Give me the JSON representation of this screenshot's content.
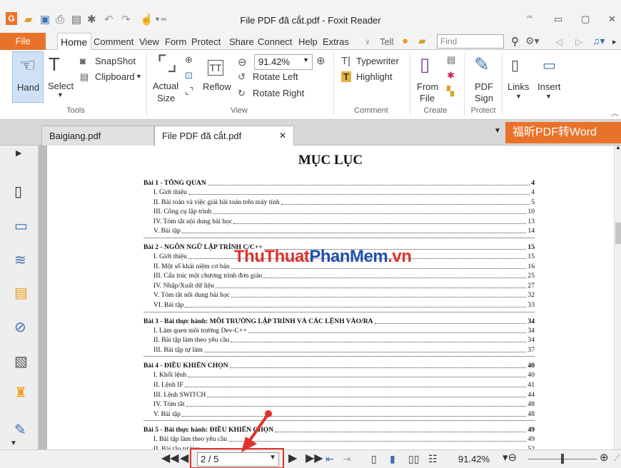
{
  "window": {
    "title": "File PDF đã cắt.pdf - Foxit Reader"
  },
  "menu": {
    "file": "File",
    "tabs": [
      "Home",
      "Comment",
      "View",
      "Form",
      "Protect",
      "Share",
      "Connect",
      "Help",
      "Extras"
    ],
    "tell": "Tell",
    "find_placeholder": "Find"
  },
  "ribbon": {
    "hand": "Hand",
    "select": "Select",
    "snapshot": "SnapShot",
    "clipboard": "Clipboard",
    "tools_group": "Tools",
    "actual_size": [
      "Actual",
      "Size"
    ],
    "reflow": "Reflow",
    "zoom_value": "91.42%",
    "rotate_left": "Rotate Left",
    "rotate_right": "Rotate Right",
    "view_group": "View",
    "typewriter": "Typewriter",
    "highlight": "Highlight",
    "comment_group": "Comment",
    "from_file": [
      "From",
      "File"
    ],
    "create_group": "Create",
    "pdf_sign": [
      "PDF",
      "Sign"
    ],
    "protect_group": "Protect",
    "links": "Links",
    "insert": "Insert"
  },
  "doc_tabs": [
    {
      "label": "Baigiang.pdf",
      "active": false
    },
    {
      "label": "File PDF đã cắt.pdf",
      "active": true
    }
  ],
  "promo": "福昕PDF转Word",
  "toc": {
    "title": "MỤC LỤC",
    "sections": [
      {
        "title": "Bài 1 - TỔNG QUAN",
        "page": "4",
        "items": [
          {
            "t": "I. Giới thiệu",
            "p": "4"
          },
          {
            "t": "II. Bài toán và việc giải bài toán trên máy tính",
            "p": "5"
          },
          {
            "t": "III. Công cụ lập trình",
            "p": "10"
          },
          {
            "t": "IV. Tóm tắt nội dung bài học",
            "p": "13"
          },
          {
            "t": "V. Bài tập",
            "p": "14"
          }
        ]
      },
      {
        "title": "Bài 2 - NGÔN NGỮ LẬP TRÌNH C/C++",
        "page": "15",
        "items": [
          {
            "t": "I. Giới thiệu",
            "p": "15"
          },
          {
            "t": "II. Một số khái niệm cơ bản",
            "p": "16"
          },
          {
            "t": "III. Cấu trúc một chương trình đơn giản",
            "p": "25"
          },
          {
            "t": "IV. Nhập/Xuất dữ liệu",
            "p": "27"
          },
          {
            "t": "V. Tóm tắt nội dung bài học",
            "p": "32"
          },
          {
            "t": "VI. Bài tập",
            "p": "33"
          }
        ]
      },
      {
        "title": "Bài 3 - Bài thực hành: MÔI TRƯỜNG LẬP TRÌNH VÀ CÁC LỆNH VÀO/RA",
        "page": "34",
        "items": [
          {
            "t": "I. Làm quen môi trường Dev-C++",
            "p": "34"
          },
          {
            "t": "II. Bài tập làm theo yêu cầu",
            "p": "34"
          },
          {
            "t": "III. Bài tập tự làm",
            "p": "37"
          }
        ]
      },
      {
        "title": "Bài 4 - ĐIỀU KHIỂN CHỌN",
        "page": "40",
        "items": [
          {
            "t": "I. Khối lệnh",
            "p": "40"
          },
          {
            "t": "II. Lệnh IF",
            "p": "41"
          },
          {
            "t": "III. Lệnh SWITCH",
            "p": "44"
          },
          {
            "t": "IV. Tóm tắt",
            "p": "48"
          },
          {
            "t": "V. Bài tập",
            "p": "48"
          }
        ]
      },
      {
        "title": "Bài 5 - Bài thực hành: ĐIỀU KHIỂN CHỌN",
        "page": "49",
        "items": [
          {
            "t": "I. Bài tập làm theo yêu cầu",
            "p": "49"
          },
          {
            "t": "II. Bài tập tự làm",
            "p": "52"
          }
        ]
      }
    ]
  },
  "watermark": {
    "part1": "ThuThuat",
    "part2": "PhanMem",
    "part3": ".vn"
  },
  "status": {
    "page_field": "2 / 5",
    "zoom": "91.42%"
  },
  "colors": {
    "accent": "#e9722a",
    "highlight_box": "#e0322b",
    "watermark_red": "#e0322b",
    "watermark_blue": "#1f4fb0"
  }
}
